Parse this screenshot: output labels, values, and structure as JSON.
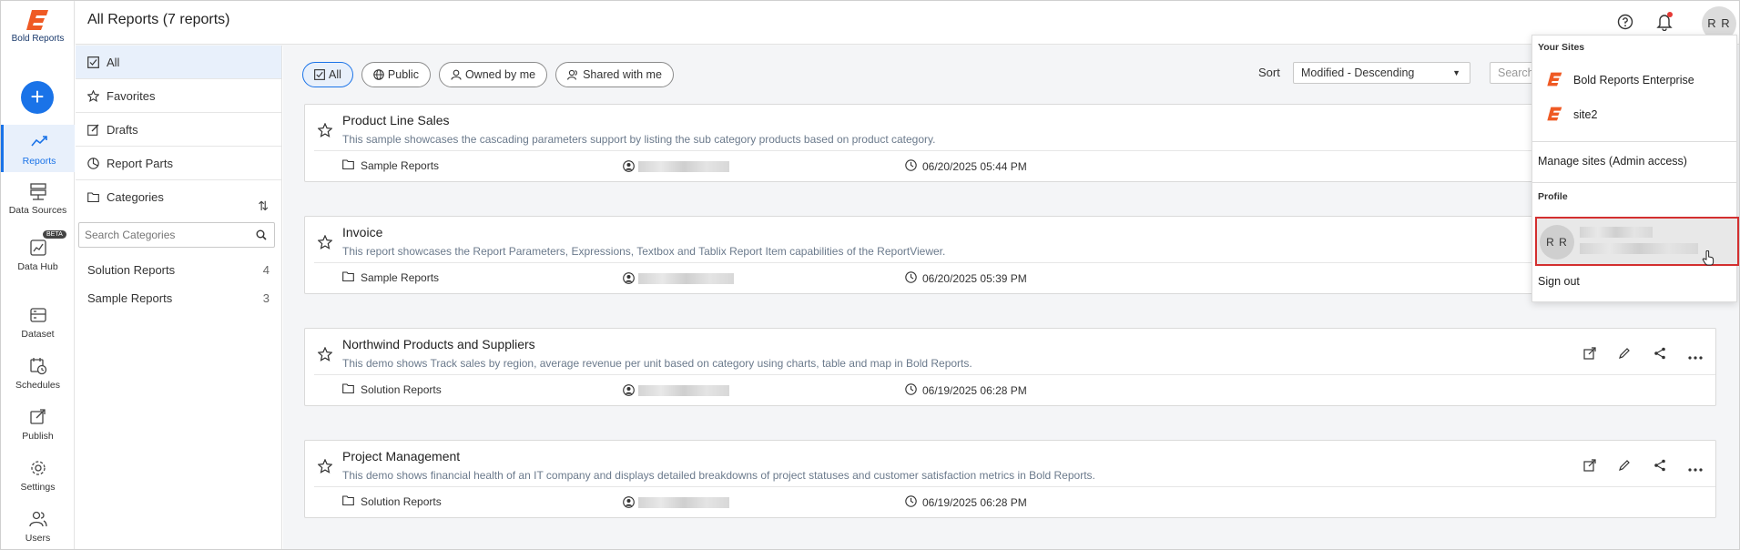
{
  "app": {
    "brand": "Bold Reports",
    "page_title": "All Reports (7 reports)",
    "avatar_initials": "R R",
    "colors": {
      "accent": "#1a73e8",
      "logo": "#ef5a24",
      "highlight_border": "#d32f2f"
    }
  },
  "rail": {
    "add_icon": "plus-icon",
    "items": [
      {
        "label": "Reports",
        "icon": "trend-icon"
      },
      {
        "label": "Data Sources",
        "icon": "database-icon"
      },
      {
        "label": "Data Hub",
        "icon": "datahub-icon",
        "badge": "BETA"
      },
      {
        "label": "Dataset",
        "icon": "dataset-icon"
      },
      {
        "label": "Schedules",
        "icon": "calendar-clock-icon"
      },
      {
        "label": "Publish",
        "icon": "publish-icon"
      },
      {
        "label": "Settings",
        "icon": "gear-icon"
      },
      {
        "label": "Users",
        "icon": "users-icon"
      }
    ]
  },
  "sidebar": {
    "items": [
      {
        "label": "All",
        "icon": "check-square-icon"
      },
      {
        "label": "Favorites",
        "icon": "star-icon"
      },
      {
        "label": "Drafts",
        "icon": "edit-icon"
      },
      {
        "label": "Report Parts",
        "icon": "pie-icon"
      },
      {
        "label": "Categories",
        "icon": "folder-icon"
      }
    ],
    "search_placeholder": "Search Categories",
    "categories": [
      {
        "name": "Solution Reports",
        "count": "4"
      },
      {
        "name": "Sample Reports",
        "count": "3"
      }
    ]
  },
  "filters": {
    "chips": [
      "All",
      "Public",
      "Owned by me",
      "Shared with me"
    ],
    "sort_label": "Sort",
    "sort_value": "Modified - Descending",
    "search_placeholder": "Search"
  },
  "reports": [
    {
      "title": "Product Line Sales",
      "description": "This sample showcases the cascading parameters support by listing the sub category products based on product category.",
      "category": "Sample Reports",
      "modified": "06/20/2025 05:44 PM"
    },
    {
      "title": "Invoice",
      "description": "This report showcases the Report Parameters, Expressions, Textbox and Tablix Report Item capabilities of the ReportViewer.",
      "category": "Sample Reports",
      "modified": "06/20/2025 05:39 PM"
    },
    {
      "title": "Northwind Products and Suppliers",
      "description": "This demo shows Track sales by region, average revenue per unit based on category using charts, table and map in Bold Reports.",
      "category": "Solution Reports",
      "modified": "06/19/2025 06:28 PM"
    },
    {
      "title": "Project Management",
      "description": "This demo shows financial health of an IT company and displays detailed breakdowns of project statuses and customer satisfaction metrics in Bold Reports.",
      "category": "Solution Reports",
      "modified": "06/19/2025 06:28 PM"
    }
  ],
  "dropdown": {
    "your_sites_label": "Your Sites",
    "sites": [
      "Bold Reports Enterprise",
      "site2"
    ],
    "manage_sites": "Manage sites (Admin access)",
    "profile_label": "Profile",
    "profile_initials": "R R",
    "sign_out": "Sign out"
  }
}
